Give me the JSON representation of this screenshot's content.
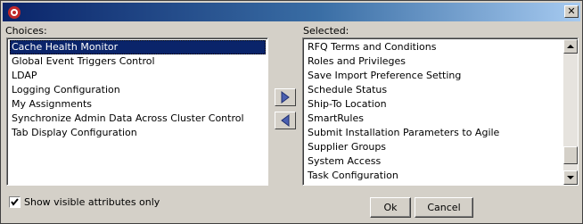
{
  "window": {
    "title": "",
    "close_label": "✕"
  },
  "choices": {
    "label": "Choices:",
    "items": [
      "Cache Health Monitor",
      "Global Event Triggers Control",
      "LDAP",
      "Logging Configuration",
      "My Assignments",
      "Synchronize Admin Data Across Cluster Control",
      "Tab Display Configuration"
    ],
    "selected_index": 0
  },
  "selected": {
    "label": "Selected:",
    "items": [
      "RFQ Terms and Conditions",
      "Roles and Privileges",
      "Save Import Preference Setting",
      "Schedule Status",
      "Ship-To Location",
      "SmartRules",
      "Submit Installation Parameters to Agile",
      "Supplier Groups",
      "System Access",
      "Task Configuration"
    ],
    "scroll_position": 0.93
  },
  "options": {
    "show_visible_label": "Show visible attributes only",
    "show_visible_checked": true
  },
  "buttons": {
    "ok_label": "Ok",
    "cancel_label": "Cancel"
  },
  "colors": {
    "selection": "#0a246a",
    "arrow": "#4a5fb0",
    "app_icon": "#c0282a"
  }
}
